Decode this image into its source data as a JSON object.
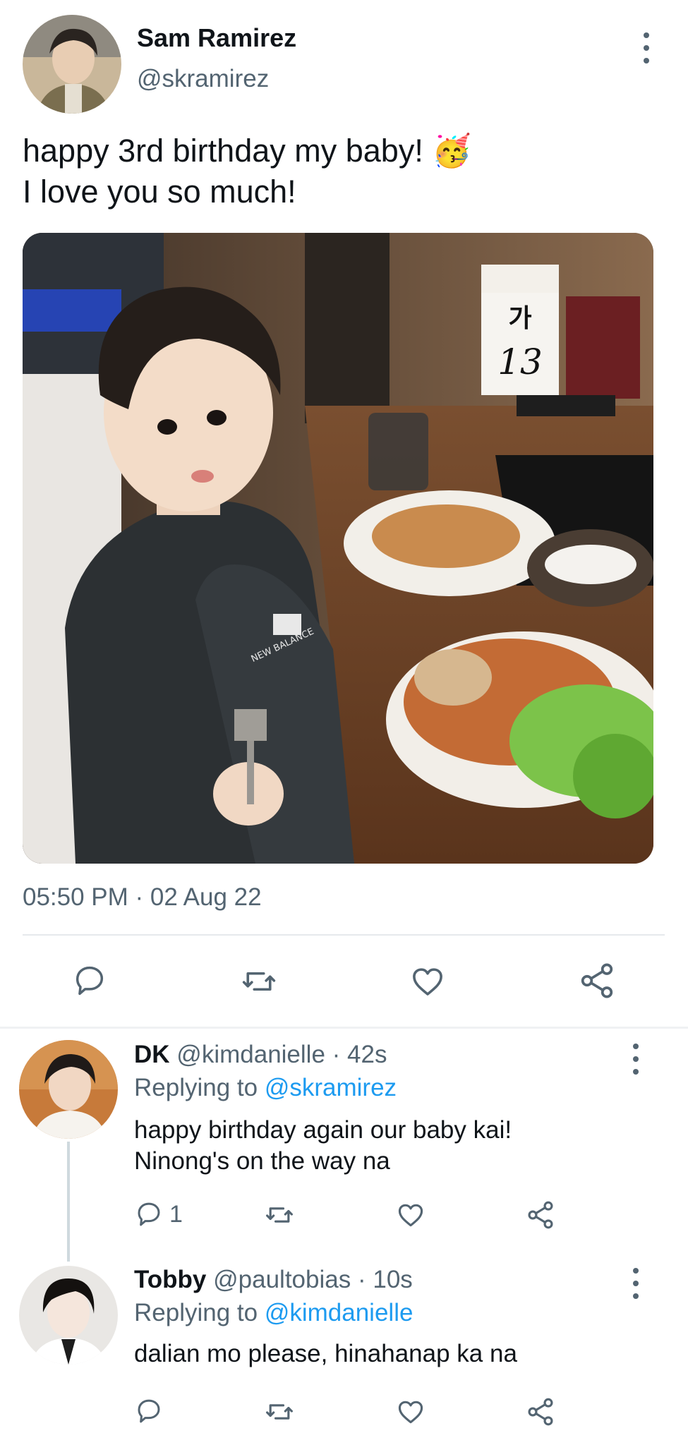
{
  "tweet": {
    "author_name": "Sam Ramirez",
    "author_handle": "@skramirez",
    "text_line1": "happy 3rd birthday my baby! ",
    "emoji": "🥳",
    "text_line2": "I love you so much!",
    "timestamp": "05:50 PM · 02 Aug 22",
    "photo_signs": {
      "table_letter": "가",
      "table_number": "13",
      "hoodie_brand": "NEW BALANCE"
    }
  },
  "replies": [
    {
      "name": "DK",
      "handle": "@kimdanielle",
      "sep": "·",
      "time": "42s",
      "replying_prefix": "Replying to ",
      "replying_to": "@skramirez",
      "text_line1": "happy birthday again our baby kai!",
      "text_line2": "Ninong's on the way na",
      "reply_count": "1"
    },
    {
      "name": "Tobby",
      "handle": "@paultobias",
      "sep": "·",
      "time": "10s",
      "replying_prefix": "Replying to ",
      "replying_to": "@kimdanielle",
      "text_line1": "dalian mo please, hinahanap ka na"
    }
  ],
  "colors": {
    "accent": "#1d9bf0",
    "text": "#0f1419",
    "secondary": "#536471",
    "divider": "#e6e9ec"
  },
  "icons": [
    "more-icon",
    "reply-icon",
    "retweet-icon",
    "like-icon",
    "share-icon"
  ]
}
